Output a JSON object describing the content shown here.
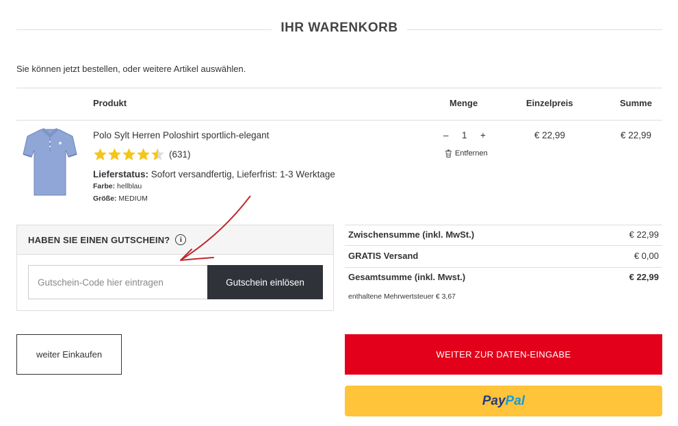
{
  "page": {
    "title": "IHR WARENKORB",
    "intro": "Sie können jetzt bestellen, oder weitere Artikel auswählen."
  },
  "table": {
    "headers": {
      "product": "Produkt",
      "quantity": "Menge",
      "unit_price": "Einzelpreis",
      "total": "Summe"
    }
  },
  "item": {
    "name": "Polo Sylt Herren Poloshirt sportlich-elegant",
    "rating_stars": 4.5,
    "rating_count": "(631)",
    "status_label": "Lieferstatus:",
    "status_value": "Sofort versandfertig, Lieferfrist: 1-3 Werktage",
    "color_label": "Farbe:",
    "color_value": "hellblau",
    "size_label": "Größe:",
    "size_value": "MEDIUM",
    "qty_minus": "–",
    "qty": "1",
    "qty_plus": "+",
    "remove_label": "Entfernen",
    "unit_price": "€ 22,99",
    "total": "€ 22,99",
    "shirt_color": "#8fa6d6"
  },
  "coupon": {
    "heading": "HABEN SIE EINEN GUTSCHEIN?",
    "info_glyph": "i",
    "placeholder": "Gutschein-Code hier eintragen",
    "button": "Gutschein einlösen"
  },
  "totals": {
    "subtotal_label": "Zwischensumme (inkl. MwSt.)",
    "subtotal_value": "€ 22,99",
    "shipping_label": "GRATIS Versand",
    "shipping_value": "€ 0,00",
    "grand_label": "Gesamtsumme (inkl. Mwst.)",
    "grand_value": "€ 22,99",
    "vat_note": "enthaltene Mehrwertsteuer € 3,67"
  },
  "actions": {
    "continue_shopping": "weiter Einkaufen",
    "checkout": "WEITER ZUR DATEN-EINGABE",
    "paypal_part1": "Pay",
    "paypal_part2": "Pal"
  },
  "colors": {
    "accent_red": "#e2001a",
    "paypal_yellow": "#ffc439",
    "dark_button": "#2f3339",
    "star": "#f5c518",
    "annotation_arrow": "#c0282d"
  }
}
